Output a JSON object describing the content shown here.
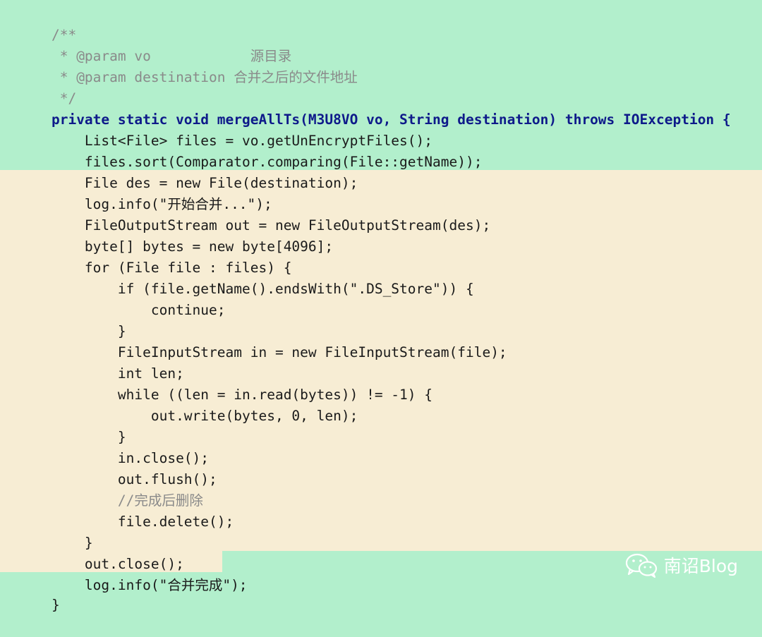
{
  "code_lines": [
    "/**",
    " * @param vo            源目录",
    " * @param destination 合并之后的文件地址",
    " */",
    "private static void mergeAllTs(M3U8VO vo, String destination) throws IOException {",
    "    List<File> files = vo.getUnEncryptFiles();",
    "    files.sort(Comparator.comparing(File::getName));",
    "    File des = new File(destination);",
    "    log.info(\"开始合并...\");",
    "    FileOutputStream out = new FileOutputStream(des);",
    "    byte[] bytes = new byte[4096];",
    "    for (File file : files) {",
    "        if (file.getName().endsWith(\".DS_Store\")) {",
    "            continue;",
    "        }",
    "        FileInputStream in = new FileInputStream(file);",
    "        int len;",
    "        while ((len = in.read(bytes)) != -1) {",
    "            out.write(bytes, 0, len);",
    "        }",
    "        in.close();",
    "        out.flush();",
    "        //完成后删除",
    "        file.delete();",
    "    }",
    "    out.close();",
    "    log.info(\"合并完成\");",
    "}"
  ],
  "watermark": {
    "icon": "wechat-icon",
    "text": "南诏Blog"
  },
  "colors": {
    "background": "#b2efcc",
    "highlight": "#f7edd4",
    "keyword": "#0e1a8a",
    "type": "#2a7fd4",
    "field": "#a51ec8",
    "string": "#1f7a1f",
    "comment": "#8a8a8a"
  }
}
